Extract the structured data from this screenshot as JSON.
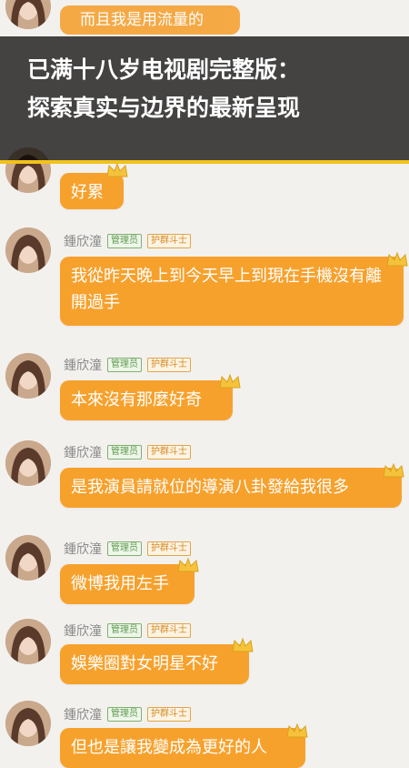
{
  "banner": {
    "line1": "已满十八岁电视剧完整版：",
    "line2": "探索真实与边界的最新呈现"
  },
  "partial_top_message": "而且我是用流量的",
  "accent_color": "#f7a12d",
  "messages": [
    {
      "name": "",
      "badge_admin": "",
      "badge_fighter": "",
      "text": "好累"
    },
    {
      "name": "鍾欣潼",
      "badge_admin": "管理员",
      "badge_fighter": "护群斗士",
      "text": "我從昨天晚上到今天早上到現在手機沒有離開過手"
    },
    {
      "name": "鍾欣潼",
      "badge_admin": "管理员",
      "badge_fighter": "护群斗士",
      "text": "本來沒有那麼好奇"
    },
    {
      "name": "鍾欣潼",
      "badge_admin": "管理员",
      "badge_fighter": "护群斗士",
      "text": "是我演員請就位的導演八卦發給我很多"
    },
    {
      "name": "鍾欣潼",
      "badge_admin": "管理员",
      "badge_fighter": "护群斗士",
      "text": "微博我用左手"
    },
    {
      "name": "鍾欣潼",
      "badge_admin": "管理员",
      "badge_fighter": "护群斗士",
      "text": "娛樂圈對女明星不好"
    },
    {
      "name": "鍾欣潼",
      "badge_admin": "管理员",
      "badge_fighter": "护群斗士",
      "text": "但也是讓我變成為更好的人"
    }
  ]
}
